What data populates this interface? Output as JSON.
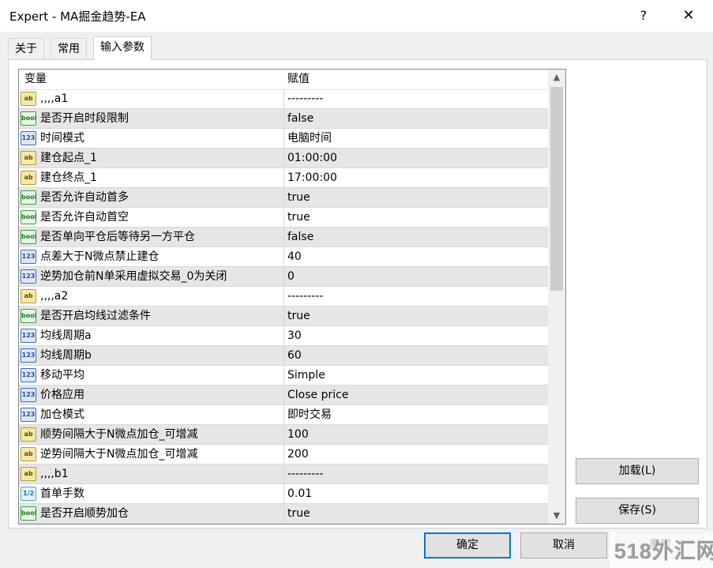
{
  "window": {
    "title": "Expert - MA掘金趋势-EA",
    "help_label": "?",
    "close_label": "✕"
  },
  "tabs": [
    {
      "label": "关于"
    },
    {
      "label": "常用"
    },
    {
      "label": "输入参数",
      "active": true
    }
  ],
  "table": {
    "columns": [
      "变量",
      "赋值"
    ],
    "rows": [
      {
        "icon": "ab",
        "name": ",,,,a1",
        "value": "---------"
      },
      {
        "icon": "bool",
        "name": "是否开启时段限制",
        "value": "false"
      },
      {
        "icon": "123",
        "name": "时间模式",
        "value": "电脑时间"
      },
      {
        "icon": "ab",
        "name": "建仓起点_1",
        "value": "01:00:00"
      },
      {
        "icon": "ab",
        "name": "建仓终点_1",
        "value": "17:00:00"
      },
      {
        "icon": "bool",
        "name": "是否允许自动首多",
        "value": "true"
      },
      {
        "icon": "bool",
        "name": "是否允许自动首空",
        "value": "true"
      },
      {
        "icon": "bool",
        "name": "是否单向平仓后等待另一方平仓",
        "value": "false"
      },
      {
        "icon": "123",
        "name": "点差大于N微点禁止建仓",
        "value": "40"
      },
      {
        "icon": "123",
        "name": "逆势加仓前N单采用虚拟交易_0为关闭",
        "value": "0"
      },
      {
        "icon": "ab",
        "name": ",,,,a2",
        "value": "---------"
      },
      {
        "icon": "bool",
        "name": "是否开启均线过滤条件",
        "value": "true"
      },
      {
        "icon": "123",
        "name": "均线周期a",
        "value": "30"
      },
      {
        "icon": "123",
        "name": "均线周期b",
        "value": "60"
      },
      {
        "icon": "123",
        "name": "移动平均",
        "value": "Simple"
      },
      {
        "icon": "123",
        "name": "价格应用",
        "value": "Close price"
      },
      {
        "icon": "123",
        "name": "加仓模式",
        "value": "即时交易"
      },
      {
        "icon": "ab",
        "name": "顺势间隔大于N微点加仓_可增减",
        "value": "100"
      },
      {
        "icon": "ab",
        "name": "逆势间隔大于N微点加仓_可增减",
        "value": "200"
      },
      {
        "icon": "ab",
        "name": ",,,,b1",
        "value": "---------"
      },
      {
        "icon": "1/2",
        "name": "首单手数",
        "value": "0.01"
      },
      {
        "icon": "bool",
        "name": "是否开启顺势加仓",
        "value": "true"
      }
    ]
  },
  "buttons": {
    "load": "加载(L)",
    "save": "保存(S)",
    "ok": "确定",
    "cancel": "取消",
    "reset": "重置"
  },
  "watermark": "518外汇网"
}
